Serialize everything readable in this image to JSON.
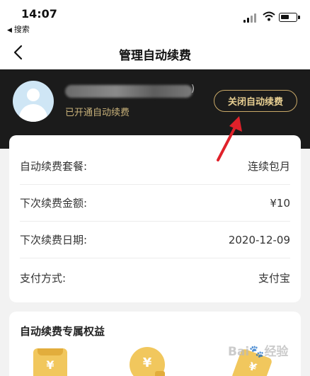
{
  "status_bar": {
    "time": "14:07",
    "back_app": "搜索"
  },
  "nav": {
    "title": "管理自动续费"
  },
  "header": {
    "username_suffix": ")",
    "status_text": "已开通自动续费",
    "close_button": "关闭自动续费"
  },
  "details": [
    {
      "label": "自动续费套餐:",
      "value": "连续包月"
    },
    {
      "label": "下次续费金额:",
      "value": "¥10"
    },
    {
      "label": "下次续费日期:",
      "value": "2020-12-09"
    },
    {
      "label": "支付方式:",
      "value": "支付宝"
    }
  ],
  "benefits": {
    "title": "自动续费专属权益",
    "icon_symbol": "¥"
  },
  "watermark": {
    "text": "Bai",
    "suffix": "经验"
  },
  "colors": {
    "header_bg": "#1b1b1b",
    "gold": "#c9a968",
    "arrow": "#e0212a",
    "benefit_gold": "#f1c75d"
  }
}
